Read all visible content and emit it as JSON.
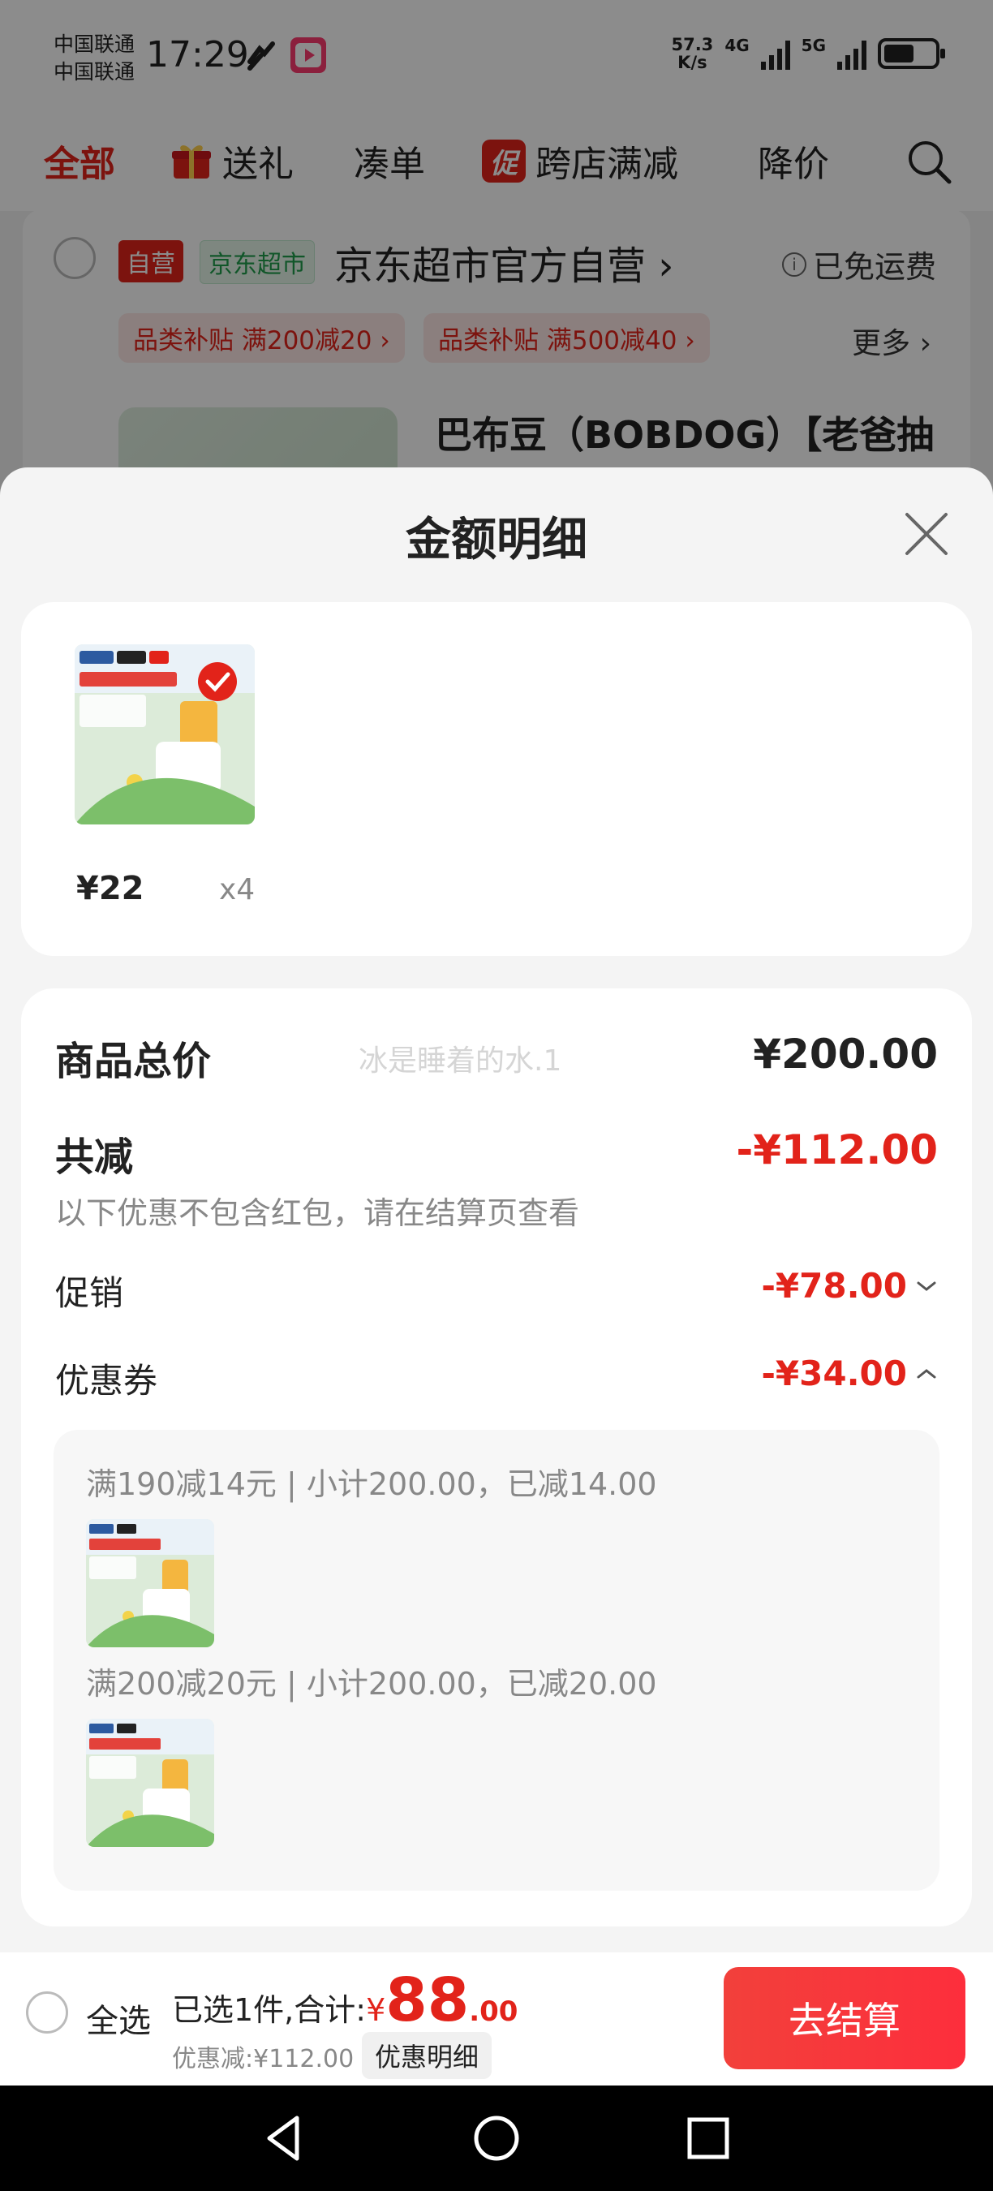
{
  "status_bar": {
    "carrier_1": "中国联通",
    "carrier_2": "中国联通",
    "time": "17:29",
    "speed_top": "57.3",
    "speed_unit": "K/s",
    "net_1": "4G",
    "net_2": "5G",
    "battery_level": 0.6
  },
  "filter_tabs": {
    "all": "全部",
    "gift": "送礼",
    "bundle": "凑单",
    "promo_badge": "促",
    "cross_store": "跨店满减",
    "price_drop": "降价"
  },
  "shop": {
    "tag_self": "自营",
    "tag_market": "京东超市",
    "name": "京东超市官方自营",
    "free_shipping": "已免运费",
    "coupon_1": "品类补贴 满200减20",
    "coupon_2": "品类补贴 满500减40",
    "more": "更多",
    "product_title": "巴布豆（BOBDOG）【老爸抽"
  },
  "sheet": {
    "title": "金额明细",
    "goods": {
      "price": "¥22",
      "qty": "x4"
    },
    "detail": {
      "total_label": "商品总价",
      "total_value": "¥200.00",
      "watermark": "冰是睡着的水.1",
      "discount_label": "共减",
      "discount_value": "-¥112.00",
      "discount_note": "以下优惠不包含红包，请在结算页查看",
      "promo_label": "促销",
      "promo_value": "-¥78.00",
      "coupon_label": "优惠券",
      "coupon_value": "-¥34.00",
      "coupon_lines": [
        "满190减14元 | 小计200.00，已减14.00",
        "满200减20元 | 小计200.00，已减20.00"
      ]
    }
  },
  "bottom_bar": {
    "select_all": "全选",
    "selected_text": "已选1件,合计:",
    "currency": "¥",
    "total_int": "88",
    "total_dec": ".00",
    "saved": "优惠减:¥112.00",
    "detail_chip": "优惠明细",
    "checkout": "去结算"
  },
  "colors": {
    "accent": "#e2231a",
    "checkout": "#fd2e3c"
  }
}
